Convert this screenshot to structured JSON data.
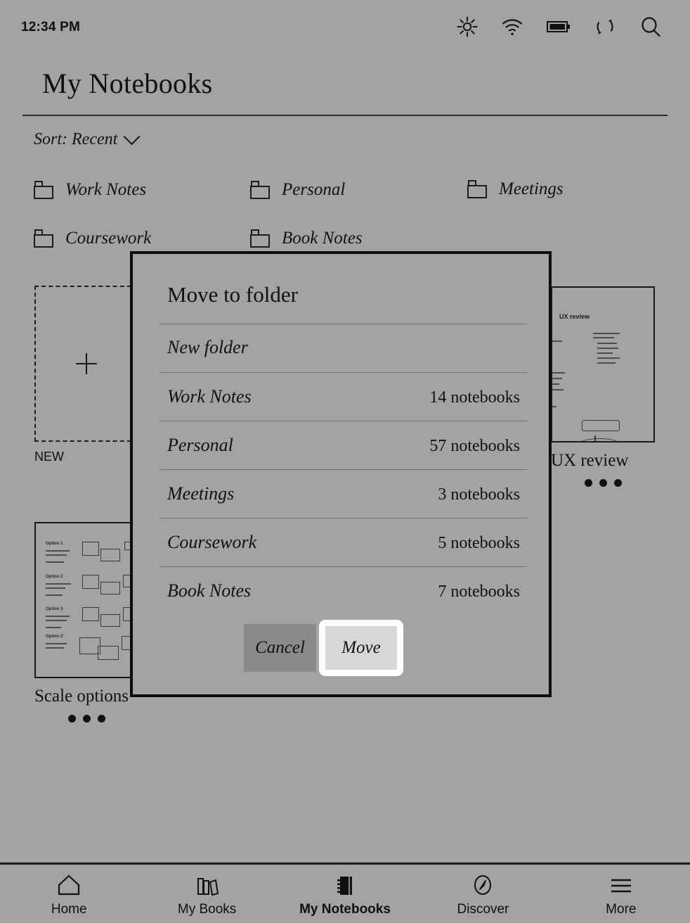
{
  "statusbar": {
    "time": "12:34 PM",
    "icons": [
      {
        "name": "brightness-icon",
        "label": "brightness"
      },
      {
        "name": "wifi-icon",
        "label": "wifi"
      },
      {
        "name": "battery-icon",
        "label": "battery"
      },
      {
        "name": "sync-icon",
        "label": "sync"
      },
      {
        "name": "search-icon",
        "label": "search"
      }
    ]
  },
  "header": {
    "title": "My Notebooks"
  },
  "sort": {
    "label": "Sort: Recent",
    "icon": "chevron-down-icon"
  },
  "folders": [
    {
      "label": "Work Notes"
    },
    {
      "label": "Personal"
    },
    {
      "label": "Meetings"
    },
    {
      "label": "Coursework"
    },
    {
      "label": "Book Notes"
    }
  ],
  "cards": {
    "new": {
      "label": "NEW",
      "icon": "plus-icon"
    },
    "ux_review": {
      "label": "UX review",
      "thumb_title": "UX review",
      "menu": "more-options"
    },
    "scale_options": {
      "label": "Scale options",
      "menu": "more-options",
      "thumb_rows": [
        "Option 1",
        "Option 2",
        "Option 3",
        "Option 2'"
      ]
    }
  },
  "modal": {
    "title": "Move to folder",
    "new_folder_label": "New folder",
    "items": [
      {
        "name": "Work Notes",
        "count": "14 notebooks"
      },
      {
        "name": "Personal",
        "count": "57 notebooks"
      },
      {
        "name": "Meetings",
        "count": "3 notebooks"
      },
      {
        "name": "Coursework",
        "count": "5 notebooks"
      },
      {
        "name": "Book Notes",
        "count": "7 notebooks"
      }
    ],
    "cancel_label": "Cancel",
    "confirm_label": "Move"
  },
  "nav": [
    {
      "label": "Home",
      "icon": "home-icon",
      "active": false
    },
    {
      "label": "My Books",
      "icon": "books-icon",
      "active": false
    },
    {
      "label": "My Notebooks",
      "icon": "notebook-icon",
      "active": true
    },
    {
      "label": "Discover",
      "icon": "compass-icon",
      "active": false
    },
    {
      "label": "More",
      "icon": "hamburger-icon",
      "active": false
    }
  ],
  "colors": {
    "background": "#a3a3a3",
    "ink": "#111111",
    "modal_border": "#0d0d0d",
    "cancel_fill": "#8a8a8a",
    "move_fill": "#d7d7d7",
    "focus_ring": "#ffffff"
  }
}
